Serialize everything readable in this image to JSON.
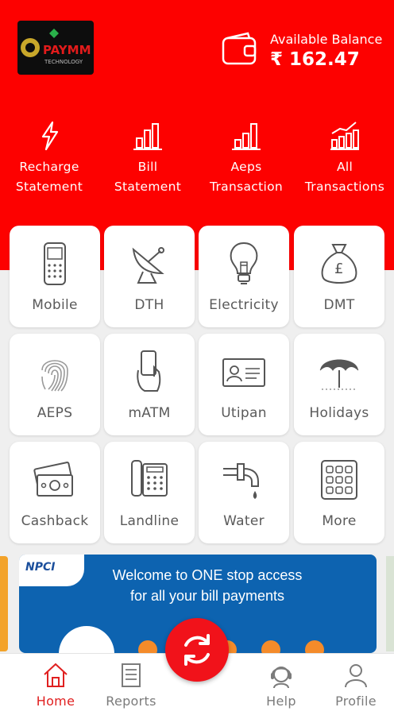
{
  "header": {
    "logo_text": "PAYMM",
    "logo_sub": "TECHNOLOGY",
    "balance_label": "Available Balance",
    "balance_value": "₹ 162.47"
  },
  "quick_actions": [
    {
      "line1": "Recharge",
      "line2": "Statement",
      "icon": "lightning-icon"
    },
    {
      "line1": "Bill",
      "line2": "Statement",
      "icon": "bar-chart-icon"
    },
    {
      "line1": "Aeps",
      "line2": "Transaction",
      "icon": "bar-chart-icon"
    },
    {
      "line1": "All",
      "line2": "Transactions",
      "icon": "growth-chart-icon"
    }
  ],
  "services": [
    {
      "label": "Mobile",
      "icon": "mobile-icon"
    },
    {
      "label": "DTH",
      "icon": "satellite-dish-icon"
    },
    {
      "label": "Electricity",
      "icon": "bulb-icon"
    },
    {
      "label": "DMT",
      "icon": "money-bag-icon"
    },
    {
      "label": "AEPS",
      "icon": "fingerprint-icon"
    },
    {
      "label": "mATM",
      "icon": "hand-phone-icon"
    },
    {
      "label": "Utipan",
      "icon": "id-card-icon"
    },
    {
      "label": "Holidays",
      "icon": "beach-umbrella-icon"
    },
    {
      "label": "Cashback",
      "icon": "cash-icon"
    },
    {
      "label": "Landline",
      "icon": "telephone-icon"
    },
    {
      "label": "Water",
      "icon": "water-tap-icon"
    },
    {
      "label": "More",
      "icon": "grid-icon"
    }
  ],
  "banner": {
    "brand": "NPCI",
    "line1": "Welcome to ONE stop access",
    "line2": "for all your bill payments"
  },
  "bottom_nav": [
    {
      "label": "Home",
      "icon": "home-icon",
      "active": true
    },
    {
      "label": "Reports",
      "icon": "reports-icon",
      "active": false
    },
    {
      "label": "Help",
      "icon": "help-icon",
      "active": false
    },
    {
      "label": "Profile",
      "icon": "profile-icon",
      "active": false
    }
  ],
  "colors": {
    "brand_red": "#fd0100",
    "active_nav": "#e02020",
    "banner_blue": "#0d63b0"
  }
}
